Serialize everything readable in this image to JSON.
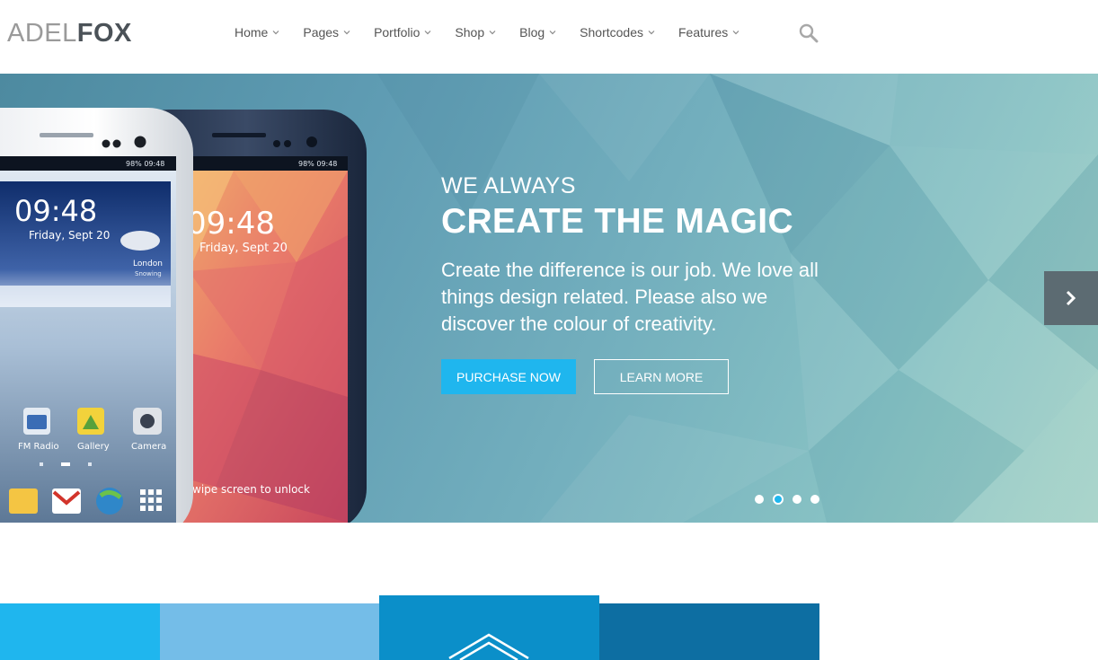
{
  "brand": {
    "light": "ADEL",
    "bold": "FOX"
  },
  "nav": {
    "items": [
      {
        "label": "Home"
      },
      {
        "label": "Pages"
      },
      {
        "label": "Portfolio"
      },
      {
        "label": "Shop"
      },
      {
        "label": "Blog"
      },
      {
        "label": "Shortcodes"
      },
      {
        "label": "Features"
      }
    ],
    "search_icon": "magnifier-icon"
  },
  "hero": {
    "eyebrow": "WE ALWAYS",
    "headline": "CREATE THE MAGIC",
    "description": "Create the difference is our job. We love all things design related. Please also we discover the colour of creativity.",
    "primary_button": "PURCHASE NOW",
    "secondary_button": "LEARN MORE",
    "slides_total": 4,
    "active_slide": 2,
    "phone_screen": {
      "time": "09:48",
      "date": "Friday, Sept 20",
      "city": "London",
      "weather": "Snowing",
      "status": "98% 09:48",
      "apps": [
        "FM Radio",
        "Gallery",
        "Camera"
      ],
      "unlock_hint": "wipe screen to unlock"
    }
  },
  "colors": {
    "accent": "#1fb6ee",
    "tile1": "#1fb6ee",
    "tile2": "#74bde8",
    "tile3": "#0b8fc9",
    "tile4": "#0d6ea2",
    "arrow_bg": "#5c6b72"
  }
}
